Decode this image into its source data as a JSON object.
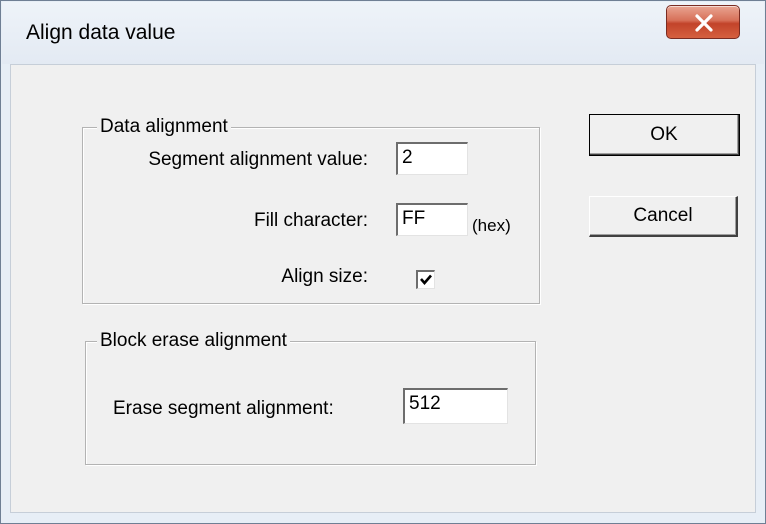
{
  "dialog": {
    "title": "Align data value"
  },
  "icons": {
    "close": "close-icon",
    "check": "check-icon"
  },
  "data_alignment": {
    "legend": "Data alignment",
    "segment_label": "Segment alignment value:",
    "segment_value": "2",
    "fill_label": "Fill character:",
    "fill_value": "FF",
    "fill_unit": "(hex)",
    "align_size_label": "Align size:",
    "align_size_checked": true
  },
  "block_erase": {
    "legend": "Block erase alignment",
    "erase_label": "Erase segment alignment:",
    "erase_value": "512"
  },
  "buttons": {
    "ok": "OK",
    "cancel": "Cancel"
  }
}
